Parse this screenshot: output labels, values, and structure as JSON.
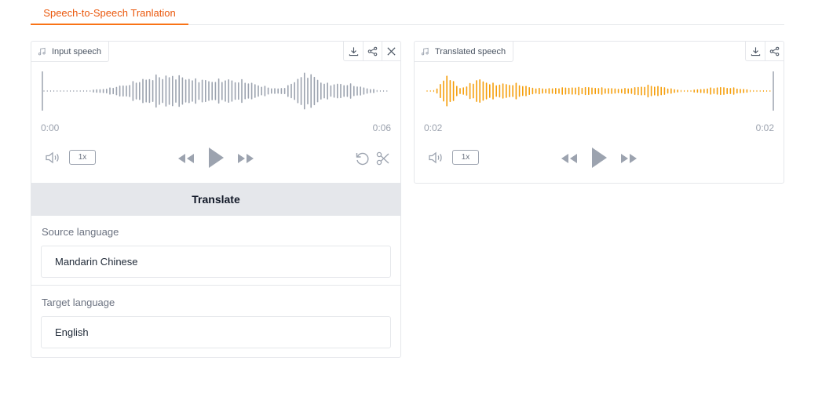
{
  "tabs": [
    {
      "label": "Speech-to-Speech Tranlation"
    }
  ],
  "input_audio": {
    "label": "Input speech",
    "time_start": "0:00",
    "time_end": "0:06",
    "speed": "1x",
    "wave_color": "#9ca3af"
  },
  "output_audio": {
    "label": "Translated speech",
    "time_start": "0:02",
    "time_end": "0:02",
    "speed": "1x",
    "wave_color": "#f59e0b"
  },
  "translate_button": "Translate",
  "source_language": {
    "label": "Source language",
    "value": "Mandarin Chinese"
  },
  "target_language": {
    "label": "Target language",
    "value": "English"
  },
  "icons": [
    "music-note-icon",
    "download-icon",
    "share-icon",
    "close-icon",
    "volume-icon",
    "rewind-icon",
    "play-icon",
    "fast-forward-icon",
    "undo-icon",
    "scissors-icon"
  ],
  "colors": {
    "accent": "#f97316",
    "border": "#e5e7eb",
    "button_bg": "#e5e7eb"
  }
}
